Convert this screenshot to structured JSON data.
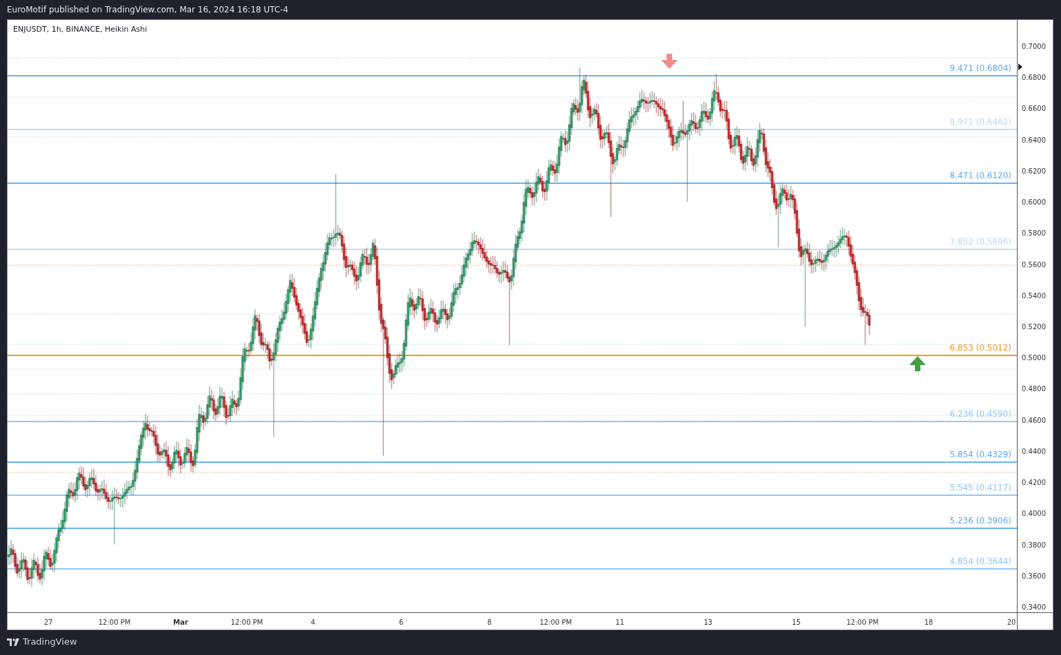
{
  "header": {
    "text": "EuroMotif published on TradingView.com, Mar 16, 2024 16:18 UTC-4"
  },
  "chart": {
    "title": "ENJUSDT, 1h, BINANCE, Heikin Ashi",
    "levels": [
      {
        "label": "9.471 (0.6804)",
        "kind": "major"
      },
      {
        "label": "8.971 (0.6462)",
        "kind": "faint"
      },
      {
        "label": "8.471 (0.6120)",
        "kind": "major"
      },
      {
        "label": "7.852 (0.5696)",
        "kind": "faint"
      },
      {
        "label": "6.853 (0.5012)",
        "kind": "key"
      },
      {
        "label": "6.236 (0.4590)",
        "kind": "minor"
      },
      {
        "label": "5.854 (0.4329)",
        "kind": "major"
      },
      {
        "label": "5.545 (0.4117)",
        "kind": "minor"
      },
      {
        "label": "5.236 (0.3906)",
        "kind": "major"
      },
      {
        "label": "4.854 (0.3644)",
        "kind": "minor"
      }
    ],
    "price_axis": [
      "0.7000",
      "0.6800",
      "0.6600",
      "0.6400",
      "0.6200",
      "0.6000",
      "0.5800",
      "0.5600",
      "0.5400",
      "0.5200",
      "0.5000",
      "0.4800",
      "0.4600",
      "0.4400",
      "0.4200",
      "0.4000",
      "0.3800",
      "0.3600",
      "0.3400"
    ],
    "time_axis": [
      {
        "text": "27",
        "kind": "day"
      },
      {
        "text": "12:00 PM",
        "kind": "day"
      },
      {
        "text": "Mar",
        "kind": "month"
      },
      {
        "text": "12:00 PM",
        "kind": "day"
      },
      {
        "text": "4",
        "kind": "day"
      },
      {
        "text": "6",
        "kind": "day"
      },
      {
        "text": "8",
        "kind": "day"
      },
      {
        "text": "12:00 PM",
        "kind": "day"
      },
      {
        "text": "11",
        "kind": "day"
      },
      {
        "text": "13",
        "kind": "day"
      },
      {
        "text": "15",
        "kind": "day"
      },
      {
        "text": "12:00 PM",
        "kind": "day"
      },
      {
        "text": "18",
        "kind": "day"
      },
      {
        "text": "20",
        "kind": "day"
      }
    ]
  },
  "footer": {
    "brand": "TradingView"
  }
}
